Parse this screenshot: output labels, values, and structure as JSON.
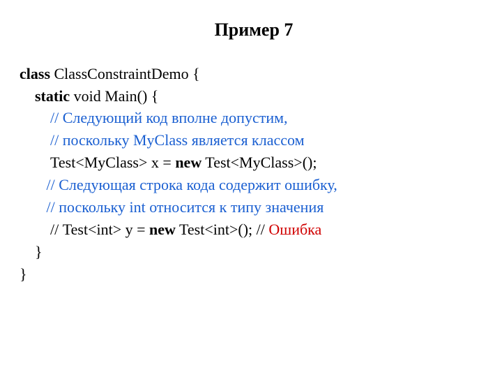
{
  "title": "Пример 7",
  "code": {
    "l1_class": "class",
    "l1_rest": " ClassConstraintDemo {",
    "l2_static": "static",
    "l2_rest": " void Main() {",
    "l3_comment": "// Следующий код вполне допустим,",
    "l4_comment": "// поскольку MyClass является классом",
    "l5_a": " Test<MyClass> x = ",
    "l5_new": "new",
    "l5_b": " Test<MyClass>();",
    "l6_comment": "// Следующая строка кода содержит ошибку,",
    "l7_comment": "// поскольку int относится к типу значения",
    "l8_a": " // Test<int> y = ",
    "l8_new": "new",
    "l8_b": " Test<int>(); // ",
    "l8_err": "Ошибка",
    "l9": "    }",
    "l10": "}"
  }
}
